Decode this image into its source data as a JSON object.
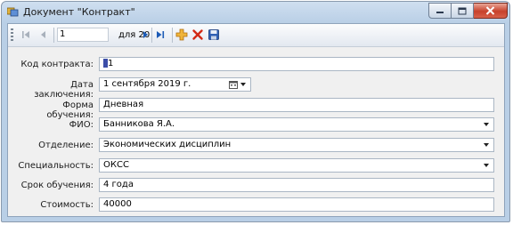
{
  "window": {
    "title": "Документ \"Контракт\""
  },
  "toolbar": {
    "position_value": "1",
    "count_label": "для 20",
    "buttons": {
      "first": "move-first-icon",
      "previous": "move-previous-icon",
      "next": "move-next-icon",
      "last": "move-last-icon",
      "add": "add-new-icon",
      "delete": "delete-icon",
      "save": "save-icon"
    }
  },
  "form": {
    "contract_code": {
      "label": "Код контракта:",
      "value": "1"
    },
    "conclusion_date": {
      "label": "Дата заключения:",
      "value": "1 сентября 2019 г."
    },
    "study_form": {
      "label": "Форма обучения:",
      "value": "Дневная"
    },
    "full_name": {
      "label": "ФИО:",
      "value": "Банникова Я.А."
    },
    "department": {
      "label": "Отделение:",
      "value": "Экономических дисциплин"
    },
    "specialty": {
      "label": "Специальность:",
      "value": "ОКСС"
    },
    "study_term": {
      "label": "Срок обучения:",
      "value": "4 года"
    },
    "cost": {
      "label": "Стоимость:",
      "value": "40000"
    }
  },
  "colors": {
    "accent": "#1c5bb6",
    "add": "#e8a21c",
    "delete": "#d22a16",
    "close": "#c7412b"
  }
}
